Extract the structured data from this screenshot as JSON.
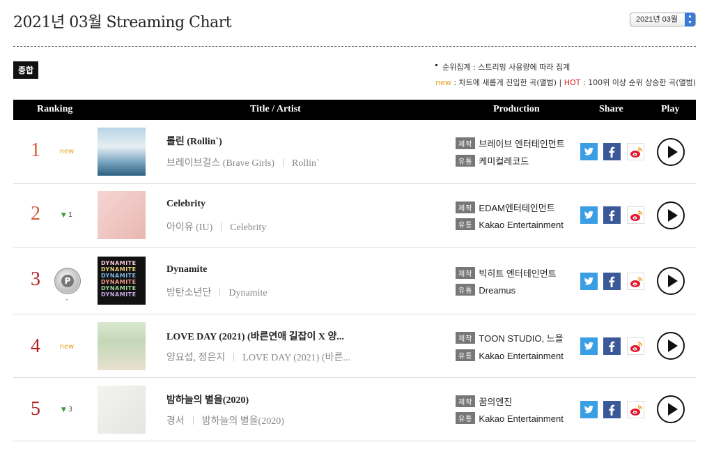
{
  "page": {
    "title": "2021년 03월 Streaming Chart",
    "month_select": "2021년 03월"
  },
  "tab": "종합",
  "notice": {
    "line1": "순위집계 : 스트리밍 사용량에 따라 집계",
    "new_word": "new",
    "new_desc": " : 차트에 새롭게 진입한 곡(앨범) | ",
    "hot_word": "HOT",
    "hot_desc": " : 100위 이상 순위 상승한 곡(앨범)"
  },
  "headers": {
    "ranking": "Ranking",
    "title_artist": "Title / Artist",
    "production": "Production",
    "share": "Share",
    "play": "Play"
  },
  "prod_tags": {
    "make": "제작",
    "dist": "유통"
  },
  "rows": [
    {
      "rank": "1",
      "change": "new",
      "title": "롤린 (Rollin`)",
      "artist": "브레이브걸스 (Brave Girls)",
      "album": "Rollin`",
      "producer": "브레이브 엔터테인먼트",
      "distributor": "케미컬레코드"
    },
    {
      "rank": "2",
      "change": "1",
      "title": "Celebrity",
      "artist": "아이유 (IU)",
      "album": "Celebrity",
      "producer": "EDAM엔터테인먼트",
      "distributor": "Kakao Entertainment"
    },
    {
      "rank": "3",
      "change": "-",
      "badge": "P",
      "title": "Dynamite",
      "artist": "방탄소년단",
      "album": "Dynamite",
      "producer": "빅히트 엔터테인먼트",
      "distributor": "Dreamus"
    },
    {
      "rank": "4",
      "change": "new",
      "title": "LOVE DAY (2021) (바른연애 길잡이 X 양...",
      "artist": "양요섭, 정은지",
      "album": "LOVE DAY (2021) (바른...",
      "producer": "TOON STUDIO, 느을",
      "distributor": "Kakao Entertainment"
    },
    {
      "rank": "5",
      "change": "3",
      "title": "밤하늘의 별을(2020)",
      "artist": "경서",
      "album": "밤하늘의 별을(2020)",
      "producer": "꿈의엔진",
      "distributor": "Kakao Entertainment"
    }
  ],
  "colors": {
    "header_bg": "#000000",
    "rank_color": "#d35a3a",
    "new_color": "#e8a020",
    "hot_color": "#e02020",
    "twitter": "#3a9ee4",
    "facebook": "#3b5998"
  }
}
